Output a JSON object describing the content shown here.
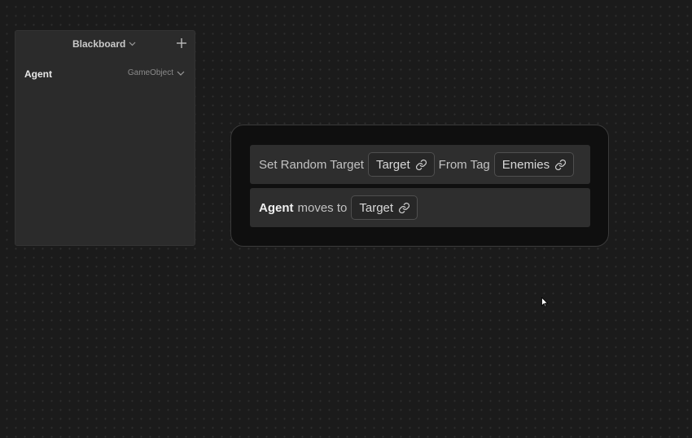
{
  "blackboard": {
    "title": "Blackboard",
    "add_icon": "plus-icon",
    "title_dropdown_icon": "chevron-down-icon",
    "variables": [
      {
        "name": "Agent",
        "type": "GameObject",
        "type_dropdown_icon": "chevron-down-icon"
      }
    ]
  },
  "node": {
    "actions": [
      {
        "prefix": "Set Random Target",
        "target_pill": "Target",
        "link_icon": "link-icon",
        "middle": "From Tag",
        "tag_pill": "Enemies"
      },
      {
        "subject": "Agent",
        "verb": "moves to",
        "target_pill": "Target",
        "link_icon": "link-icon"
      }
    ]
  },
  "colors": {
    "background": "#1b1b1b",
    "panel": "#2b2b2b",
    "node_background": "#0f0f0f",
    "action_row": "#2e2e2e",
    "pill_border": "#4f4f4f"
  }
}
